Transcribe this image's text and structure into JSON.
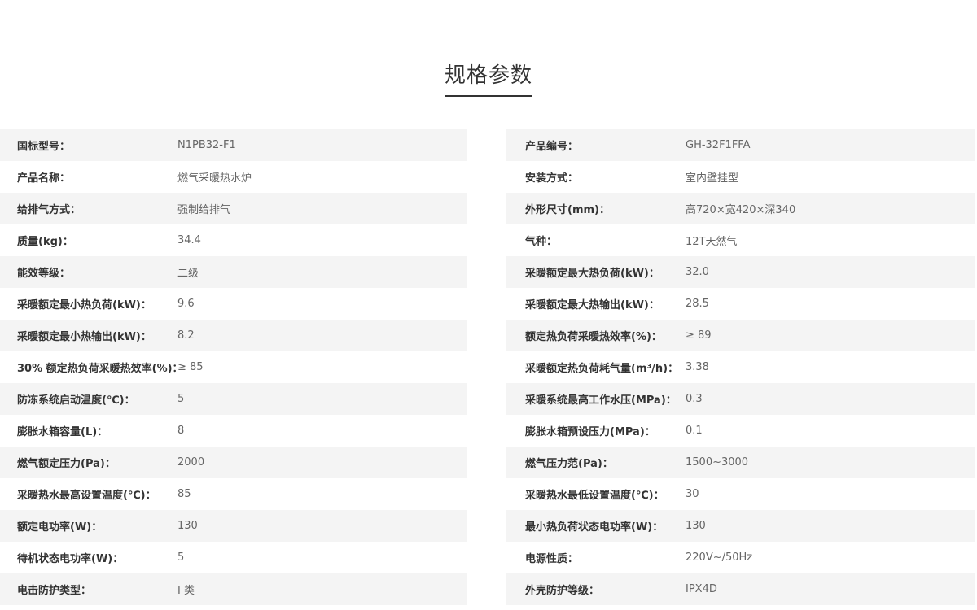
{
  "title": "规格参数",
  "left": [
    {
      "label": "国标型号：",
      "value": "N1PB32-F1"
    },
    {
      "label": "产品名称：",
      "value": "燃气采暖热水炉"
    },
    {
      "label": "给排气方式：",
      "value": "强制给排气"
    },
    {
      "label": "质量(kg)：",
      "value": "34.4"
    },
    {
      "label": "能效等级：",
      "value": "二级"
    },
    {
      "label": "采暖额定最小热负荷(kW)：",
      "value": "9.6"
    },
    {
      "label": "采暖额定最小热输出(kW)：",
      "value": "8.2"
    },
    {
      "label": "30% 额定热负荷采暖热效率(%)：",
      "value": "≥ 85"
    },
    {
      "label": "防冻系统启动温度(℃)：",
      "value": "5"
    },
    {
      "label": "膨胀水箱容量(L)：",
      "value": "8"
    },
    {
      "label": "燃气额定压力(Pa)：",
      "value": "2000"
    },
    {
      "label": "采暖热水最高设置温度(℃)：",
      "value": "85"
    },
    {
      "label": "额定电功率(W)：",
      "value": "130"
    },
    {
      "label": "待机状态电功率(W)：",
      "value": "5"
    },
    {
      "label": "电击防护类型：",
      "value": "I 类"
    }
  ],
  "right": [
    {
      "label": "产品编号：",
      "value": "GH-32F1FFA"
    },
    {
      "label": "安装方式：",
      "value": "室内壁挂型"
    },
    {
      "label": "外形尺寸(mm)：",
      "value": "高720×宽420×深340"
    },
    {
      "label": "气种：",
      "value": "12T天然气"
    },
    {
      "label": "采暖额定最大热负荷(kW)：",
      "value": "32.0"
    },
    {
      "label": "采暖额定最大热输出(kW)：",
      "value": "28.5"
    },
    {
      "label": "额定热负荷采暖热效率(%)：",
      "value": "≥ 89"
    },
    {
      "label": "采暖额定热负荷耗气量(m³/h)：",
      "value": "3.38"
    },
    {
      "label": "采暖系统最高工作水压(MPa)：",
      "value": "0.3"
    },
    {
      "label": "膨胀水箱预设压力(MPa)：",
      "value": "0.1"
    },
    {
      "label": "燃气压力范(Pa)：",
      "value": "1500~3000"
    },
    {
      "label": "采暖热水最低设置温度(℃)：",
      "value": "30"
    },
    {
      "label": "最小热负荷状态电功率(W)：",
      "value": "130"
    },
    {
      "label": "电源性质：",
      "value": "220V~/50Hz"
    },
    {
      "label": "外壳防护等级：",
      "value": "IPX4D"
    }
  ]
}
